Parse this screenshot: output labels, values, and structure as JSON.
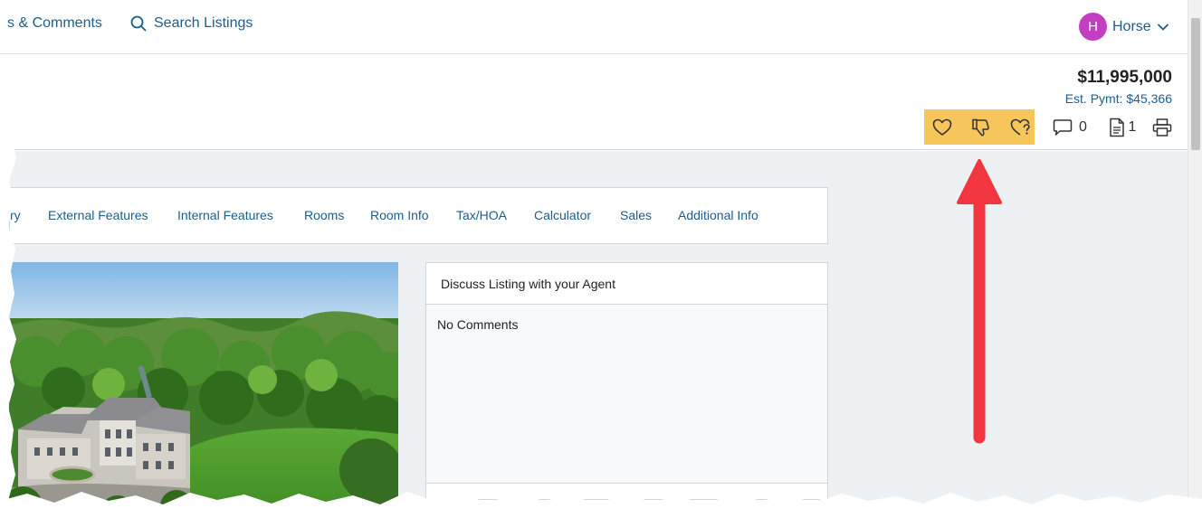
{
  "nav": {
    "partial_link": "s & Comments",
    "search_link": "Search Listings",
    "user": {
      "initial": "H",
      "name": "Horse"
    }
  },
  "listing": {
    "price": "$11,995,000",
    "est_payment": "Est. Pymt: $45,366"
  },
  "actions": {
    "comments_count": "0",
    "documents_count": "1",
    "highlight_color": "#f7c65a"
  },
  "tabs": [
    {
      "label": "ry"
    },
    {
      "label": "External Features"
    },
    {
      "label": "Internal Features"
    },
    {
      "label": "Rooms"
    },
    {
      "label": "Room Info"
    },
    {
      "label": "Tax/HOA"
    },
    {
      "label": "Calculator"
    },
    {
      "label": "Sales"
    },
    {
      "label": "Additional Info"
    }
  ],
  "discussion": {
    "title": "Discuss Listing with your Agent",
    "empty_text": "No Comments"
  },
  "colors": {
    "link": "#1c5d8c",
    "avatar": "#c43ec4",
    "annotation_arrow": "#f2363f",
    "content_bg": "#eef1f4"
  },
  "icons": [
    "search-icon",
    "chevron-down-icon",
    "heart-icon",
    "thumbs-down-icon",
    "heart-question-icon",
    "comment-icon",
    "document-icon",
    "print-icon"
  ]
}
